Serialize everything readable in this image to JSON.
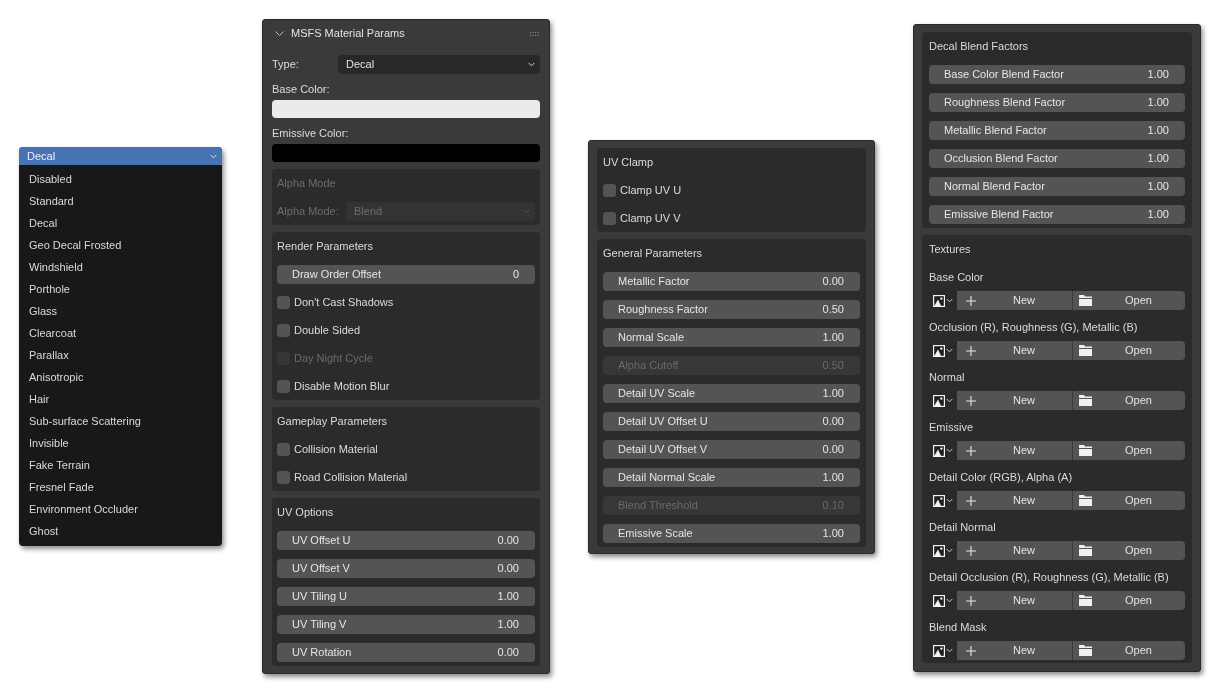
{
  "type_menu": {
    "value": "Decal",
    "items": [
      {
        "label": "Disabled"
      },
      {
        "label": "Standard"
      },
      {
        "label": "Decal"
      },
      {
        "label": "Geo Decal Frosted"
      },
      {
        "label": "Windshield"
      },
      {
        "label": "Porthole"
      },
      {
        "label": "Glass"
      },
      {
        "label": "Clearcoat"
      },
      {
        "label": "Parallax"
      },
      {
        "label": "Anisotropic"
      },
      {
        "label": "Hair"
      },
      {
        "label": "Sub-surface Scattering"
      },
      {
        "label": "Invisible"
      },
      {
        "label": "Fake Terrain"
      },
      {
        "label": "Fresnel Fade"
      },
      {
        "label": "Environment Occluder"
      },
      {
        "label": "Ghost"
      }
    ]
  },
  "panels": [
    {
      "title": "MSFS Material Params",
      "blocks": [
        {
          "kind": "dropdown",
          "label": "Type:",
          "value": "Decal",
          "disabled": false
        },
        {
          "kind": "color",
          "label": "Base Color:",
          "color": "#ebebeb"
        },
        {
          "kind": "color",
          "label": "Emissive Color:",
          "color": "#000000"
        },
        {
          "kind": "section",
          "title": "Alpha Mode",
          "disabled": true,
          "rows": [
            {
              "kind": "dropdown",
              "label": "Alpha Mode:",
              "value": "Blend",
              "disabled": true
            }
          ]
        },
        {
          "kind": "section",
          "title": "Render Parameters",
          "disabled": false,
          "rows": [
            {
              "kind": "number",
              "label": "Draw Order Offset",
              "value": "0",
              "disabled": false
            },
            {
              "kind": "checkbox",
              "label": "Don't Cast Shadows",
              "checked": false,
              "disabled": false
            },
            {
              "kind": "checkbox",
              "label": "Double Sided",
              "checked": false,
              "disabled": false
            },
            {
              "kind": "checkbox",
              "label": "Day Night Cycle",
              "checked": false,
              "disabled": true
            },
            {
              "kind": "checkbox",
              "label": "Disable Motion Blur",
              "checked": false,
              "disabled": false
            }
          ]
        },
        {
          "kind": "section",
          "title": "Gameplay Parameters",
          "disabled": false,
          "rows": [
            {
              "kind": "checkbox",
              "label": "Collision Material",
              "checked": false,
              "disabled": false
            },
            {
              "kind": "checkbox",
              "label": "Road Collision Material",
              "checked": false,
              "disabled": false
            }
          ]
        },
        {
          "kind": "section",
          "title": "UV Options",
          "disabled": false,
          "rows": [
            {
              "kind": "number",
              "label": "UV Offset U",
              "value": "0.00",
              "disabled": false
            },
            {
              "kind": "number",
              "label": "UV Offset V",
              "value": "0.00",
              "disabled": false
            },
            {
              "kind": "number",
              "label": "UV Tiling U",
              "value": "1.00",
              "disabled": false
            },
            {
              "kind": "number",
              "label": "UV Tiling V",
              "value": "1.00",
              "disabled": false
            },
            {
              "kind": "number",
              "label": "UV Rotation",
              "value": "0.00",
              "disabled": false
            }
          ]
        }
      ]
    },
    {
      "blocks": [
        {
          "kind": "section",
          "title": "UV Clamp",
          "disabled": false,
          "rows": [
            {
              "kind": "checkbox",
              "label": "Clamp UV U",
              "checked": false,
              "disabled": false
            },
            {
              "kind": "checkbox",
              "label": "Clamp UV V",
              "checked": false,
              "disabled": false
            }
          ]
        },
        {
          "kind": "section",
          "title": "General Parameters",
          "disabled": false,
          "rows": [
            {
              "kind": "number",
              "label": "Metallic Factor",
              "value": "0.00",
              "disabled": false
            },
            {
              "kind": "number",
              "label": "Roughness Factor",
              "value": "0.50",
              "disabled": false
            },
            {
              "kind": "number",
              "label": "Normal Scale",
              "value": "1.00",
              "disabled": false
            },
            {
              "kind": "number",
              "label": "Alpha Cutoff",
              "value": "0.50",
              "disabled": true
            },
            {
              "kind": "number",
              "label": "Detail UV Scale",
              "value": "1.00",
              "disabled": false
            },
            {
              "kind": "number",
              "label": "Detail UV Offset U",
              "value": "0.00",
              "disabled": false
            },
            {
              "kind": "number",
              "label": "Detail UV Offset V",
              "value": "0.00",
              "disabled": false
            },
            {
              "kind": "number",
              "label": "Detail Normal Scale",
              "value": "1.00",
              "disabled": false
            },
            {
              "kind": "number",
              "label": "Blend Threshold",
              "value": "0.10",
              "disabled": true
            },
            {
              "kind": "number",
              "label": "Emissive Scale",
              "value": "1.00",
              "disabled": false
            }
          ]
        }
      ]
    },
    {
      "blocks": [
        {
          "kind": "section",
          "title": "Decal Blend Factors",
          "disabled": false,
          "rows": [
            {
              "kind": "number",
              "label": "Base Color Blend Factor",
              "value": "1.00",
              "disabled": false
            },
            {
              "kind": "number",
              "label": "Roughness Blend Factor",
              "value": "1.00",
              "disabled": false
            },
            {
              "kind": "number",
              "label": "Metallic Blend Factor",
              "value": "1.00",
              "disabled": false
            },
            {
              "kind": "number",
              "label": "Occlusion Blend Factor",
              "value": "1.00",
              "disabled": false
            },
            {
              "kind": "number",
              "label": "Normal Blend Factor",
              "value": "1.00",
              "disabled": false
            },
            {
              "kind": "number",
              "label": "Emissive Blend Factor",
              "value": "1.00",
              "disabled": false
            }
          ]
        },
        {
          "kind": "section",
          "title": "Textures",
          "disabled": false,
          "rows": [
            {
              "kind": "texture",
              "label": "Base Color",
              "new_label": "New",
              "open_label": "Open"
            },
            {
              "kind": "texture",
              "label": "Occlusion (R), Roughness (G), Metallic (B)",
              "new_label": "New",
              "open_label": "Open"
            },
            {
              "kind": "texture",
              "label": "Normal",
              "new_label": "New",
              "open_label": "Open"
            },
            {
              "kind": "texture",
              "label": "Emissive",
              "new_label": "New",
              "open_label": "Open"
            },
            {
              "kind": "texture",
              "label": "Detail Color (RGB), Alpha (A)",
              "new_label": "New",
              "open_label": "Open"
            },
            {
              "kind": "texture",
              "label": "Detail Normal",
              "new_label": "New",
              "open_label": "Open"
            },
            {
              "kind": "texture",
              "label": "Detail Occlusion (R), Roughness (G), Metallic (B)",
              "new_label": "New",
              "open_label": "Open"
            },
            {
              "kind": "texture",
              "label": "Blend Mask",
              "new_label": "New",
              "open_label": "Open"
            }
          ]
        }
      ]
    }
  ]
}
